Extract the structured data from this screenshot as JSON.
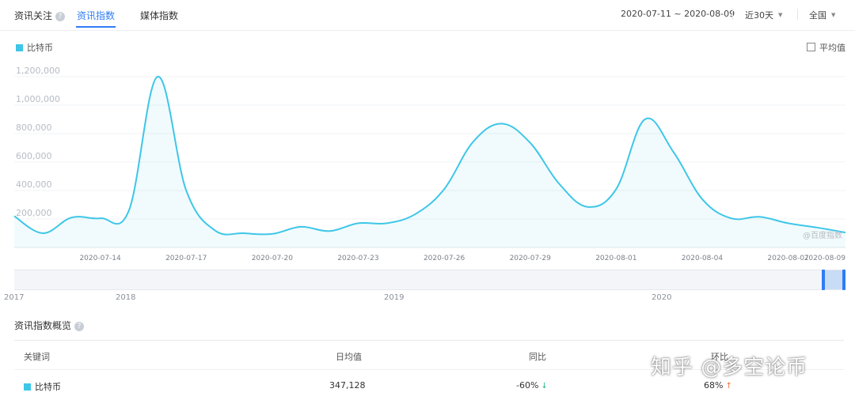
{
  "tabs": [
    {
      "label": "资讯关注",
      "active": false
    },
    {
      "label": "资讯指数",
      "active": true
    },
    {
      "label": "媒体指数",
      "active": false
    }
  ],
  "help_icon_glyph": "?",
  "filters": {
    "date_range": "2020-07-11 ~ 2020-08-09",
    "period": "近30天",
    "region": "全国"
  },
  "legend": {
    "label": "比特币",
    "color": "#3ec6e8"
  },
  "avg_toggle": {
    "label": "平均值",
    "checked": false
  },
  "watermark_chart": "@百度指数",
  "chart_data": {
    "type": "area",
    "series": [
      {
        "name": "比特币",
        "color": "#3ec6e8",
        "values": [
          220000,
          100000,
          210000,
          205000,
          260000,
          1200000,
          400000,
          120000,
          100000,
          95000,
          145000,
          115000,
          170000,
          170000,
          235000,
          410000,
          740000,
          870000,
          735000,
          450000,
          285000,
          410000,
          900000,
          670000,
          340000,
          205000,
          215000,
          170000,
          140000,
          105000
        ]
      }
    ],
    "x": [
      "2020-07-11",
      "2020-07-12",
      "2020-07-13",
      "2020-07-14",
      "2020-07-15",
      "2020-07-16",
      "2020-07-17",
      "2020-07-18",
      "2020-07-19",
      "2020-07-20",
      "2020-07-21",
      "2020-07-22",
      "2020-07-23",
      "2020-07-24",
      "2020-07-25",
      "2020-07-26",
      "2020-07-27",
      "2020-07-28",
      "2020-07-29",
      "2020-07-30",
      "2020-07-31",
      "2020-08-01",
      "2020-08-02",
      "2020-08-03",
      "2020-08-04",
      "2020-08-05",
      "2020-08-06",
      "2020-08-07",
      "2020-08-08",
      "2020-08-09"
    ],
    "x_tick_labels": [
      "2020-07-14",
      "2020-07-17",
      "2020-07-20",
      "2020-07-23",
      "2020-07-26",
      "2020-07-29",
      "2020-08-01",
      "2020-08-04",
      "2020-08-07",
      "2020-08-09"
    ],
    "y_tick_labels": [
      "200,000",
      "400,000",
      "600,000",
      "800,000",
      "1,000,000",
      "1,200,000"
    ],
    "ylim": [
      0,
      1300000
    ],
    "grid": true
  },
  "overview_years": [
    "2017",
    "2018",
    "2019",
    "2020"
  ],
  "section_title": "资讯指数概览",
  "table": {
    "headers": [
      "关键词",
      "日均值",
      "同比",
      "环比"
    ],
    "rows": [
      {
        "keyword": "比特币",
        "daily_avg": "347,128",
        "yoy": "-60%",
        "yoy_dir": "down",
        "mom": "68%",
        "mom_dir": "up"
      }
    ]
  },
  "watermark": "知乎 @多空论币"
}
